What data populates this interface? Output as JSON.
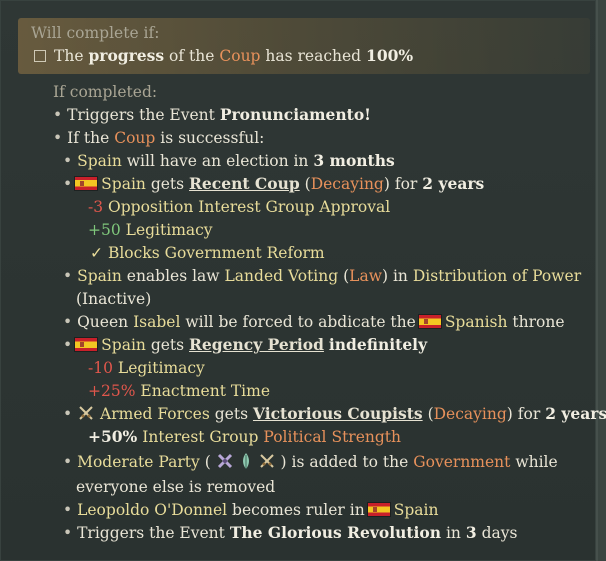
{
  "condition": {
    "header": "Will complete if:",
    "pre": "The",
    "progress": "progress",
    "of": "of the",
    "coup": "Coup",
    "mid": "has reached",
    "pct": "100%"
  },
  "if_completed": "If completed:",
  "l1": {
    "bullet": "•",
    "pre": "Triggers the Event",
    "event": "Pronunciamento!"
  },
  "l2": {
    "bullet": "•",
    "pre": "If the",
    "coup": "Coup",
    "post": "is successful:"
  },
  "l3": {
    "bullet": "•",
    "country": "Spain",
    "pre": "will have an election in",
    "months": "3 months"
  },
  "l4": {
    "bullet": "•",
    "country": "Spain",
    "gets": "gets",
    "mod": "Recent Coup",
    "p1": "(",
    "decay": "Decaying",
    "p2": ")",
    "for": "for",
    "years": "2 years"
  },
  "l5": {
    "num": "-3",
    "text": "Opposition Interest Group Approval"
  },
  "l6": {
    "num": "+50",
    "text": "Legitimacy"
  },
  "l7": {
    "check": "✓",
    "text": "Blocks Government Reform"
  },
  "l8": {
    "bullet": "•",
    "country": "Spain",
    "pre": "enables law",
    "law": "Landed Voting",
    "p1": "(",
    "lawword": "Law",
    "p2": ")",
    "in": "in",
    "group": "Distribution of Power"
  },
  "l8b": {
    "text": "(Inactive)"
  },
  "l9": {
    "bullet": "•",
    "pre": "Queen",
    "name": "Isabel",
    "mid": "will be forced to abdicate the",
    "country": "Spanish",
    "post": "throne"
  },
  "l10": {
    "bullet": "•",
    "country": "Spain",
    "gets": "gets",
    "mod": "Regency Period",
    "indef": "indefinitely"
  },
  "l11": {
    "num": "-10",
    "text": "Legitimacy"
  },
  "l12": {
    "num": "+25%",
    "text": "Enactment Time"
  },
  "l13": {
    "bullet": "•",
    "ig": "Armed Forces",
    "gets": "gets",
    "mod": "Victorious Coupists",
    "p1": "(",
    "decay": "Decaying",
    "p2": ")",
    "for": "for",
    "years": "2 years"
  },
  "l14": {
    "num": "+50%",
    "text": "Interest Group",
    "strength": "Political Strength"
  },
  "l15": {
    "bullet": "•",
    "party": "Moderate Party",
    "p1": "(",
    "p2": ")",
    "mid": "is added to the",
    "gov": "Government",
    "post": "while"
  },
  "l15b": {
    "text": "everyone else is removed"
  },
  "l16": {
    "bullet": "•",
    "name": "Leopoldo O'Donnel",
    "mid": "becomes ruler in",
    "country": "Spain"
  },
  "l17": {
    "bullet": "•",
    "pre": "Triggers the Event",
    "event": "The Glorious Revolution",
    "in": "in",
    "days": "3",
    "post": "days"
  },
  "colors": {
    "background": "#2b3331",
    "highlight": "#e8dc9a",
    "orange": "#e7915b",
    "red": "#e0574c",
    "green": "#7fc77b"
  }
}
